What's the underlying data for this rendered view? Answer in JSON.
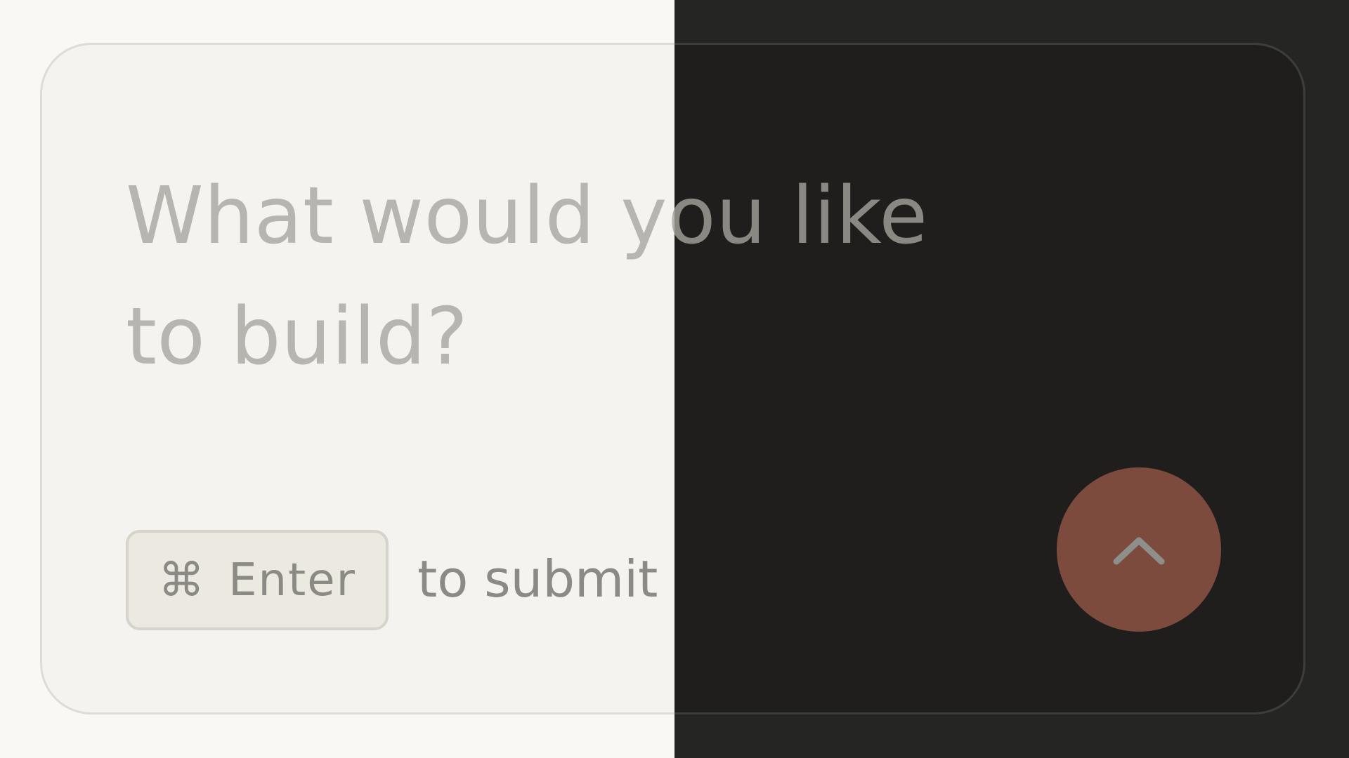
{
  "prompt": {
    "placeholder": "What would you like to build?"
  },
  "shortcut": {
    "key_icon": "⌘",
    "key_label": "Enter",
    "hint": "to submit"
  },
  "submit_button": {
    "icon": "chevron-up-icon"
  },
  "colors": {
    "light_background": "#f9f8f5",
    "dark_background": "#252523",
    "card_light": "#f4f3ef",
    "card_dark": "#1f1e1d",
    "accent": "#7d4b3e"
  }
}
